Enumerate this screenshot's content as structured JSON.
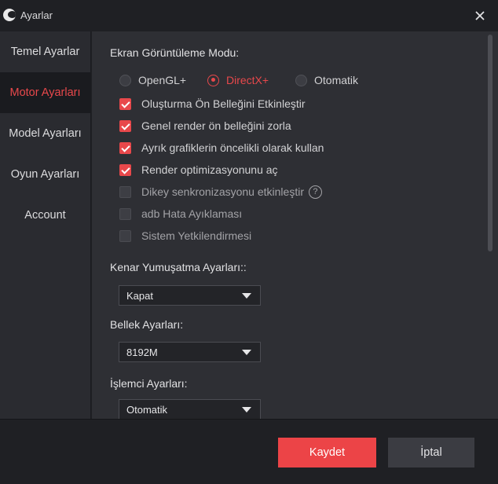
{
  "window": {
    "title": "Ayarlar"
  },
  "colors": {
    "accent": "#e8484b",
    "save_button": "#ec4447",
    "background": "#2e2f34",
    "sidebar": "#2a2b30"
  },
  "sidebar": {
    "items": [
      {
        "label": "Temel Ayarlar",
        "active": false
      },
      {
        "label": "Motor Ayarları",
        "active": true
      },
      {
        "label": "Model Ayarları",
        "active": false
      },
      {
        "label": "Oyun Ayarları",
        "active": false
      },
      {
        "label": "Account",
        "active": false
      }
    ]
  },
  "display_mode": {
    "title": "Ekran Görüntüleme Modu:",
    "options": [
      {
        "label": "OpenGL+",
        "selected": false
      },
      {
        "label": "DirectX+",
        "selected": true
      },
      {
        "label": "Otomatik",
        "selected": false
      }
    ]
  },
  "checkboxes": [
    {
      "label": "Oluşturma Ön Belleğini Etkinleştir",
      "checked": true
    },
    {
      "label": "Genel render ön belleğini zorla",
      "checked": true
    },
    {
      "label": "Ayrık grafiklerin öncelikli olarak kullan",
      "checked": true
    },
    {
      "label": "Render optimizasyonunu aç",
      "checked": true
    },
    {
      "label": "Dikey senkronizasyonu etkinleştir",
      "checked": false,
      "help": "?"
    },
    {
      "label": "adb Hata Ayıklaması",
      "checked": false
    },
    {
      "label": "Sistem Yetkilendirmesi",
      "checked": false
    }
  ],
  "antialias": {
    "title": "Kenar Yumuşatma Ayarları::",
    "value": "Kapat"
  },
  "memory": {
    "title": "Bellek Ayarları:",
    "value": "8192M"
  },
  "cpu": {
    "title": "İşlemci Ayarları:",
    "value": "Otomatik"
  },
  "footer": {
    "save_label": "Kaydet",
    "cancel_label": "İptal"
  }
}
